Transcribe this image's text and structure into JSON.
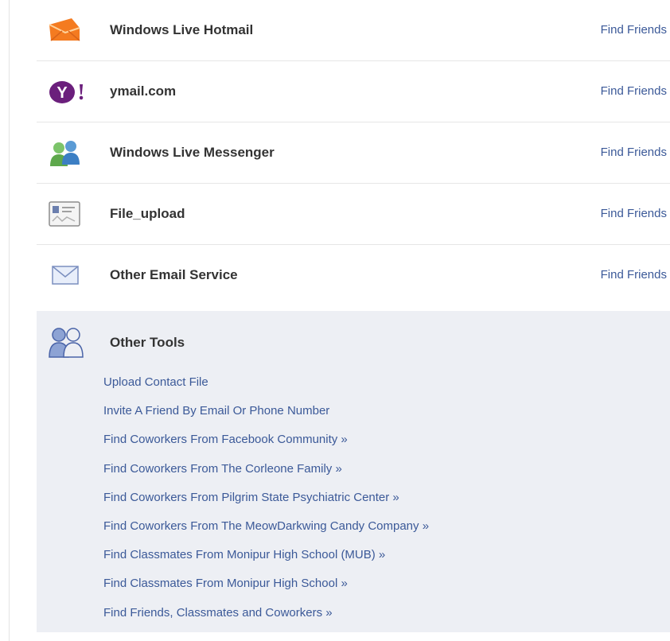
{
  "services": [
    {
      "name": "Windows Live Hotmail",
      "action": "Find Friends",
      "icon": "hotmail-icon"
    },
    {
      "name": "ymail.com",
      "action": "Find Friends",
      "icon": "yahoo-icon"
    },
    {
      "name": "Windows Live Messenger",
      "action": "Find Friends",
      "icon": "messenger-icon"
    },
    {
      "name": "File_upload",
      "action": "Find Friends",
      "icon": "contact-card-icon"
    },
    {
      "name": "Other Email Service",
      "action": "Find Friends",
      "icon": "envelope-icon"
    }
  ],
  "other_tools": {
    "title": "Other Tools",
    "icon": "people-icon",
    "links": [
      "Upload Contact File",
      "Invite A Friend By Email Or Phone Number",
      "Find Coworkers From Facebook Community »",
      "Find Coworkers From The Corleone Family »",
      "Find Coworkers From Pilgrim State Psychiatric Center »",
      "Find Coworkers From The MeowDarkwing Candy Company »",
      "Find Classmates From Monipur High School (MUB) »",
      "Find Classmates From Monipur High School »",
      "Find Friends, Classmates and Coworkers »"
    ]
  },
  "colors": {
    "link": "#3b5998",
    "tools_background": "#edeff4",
    "text": "#333333"
  }
}
